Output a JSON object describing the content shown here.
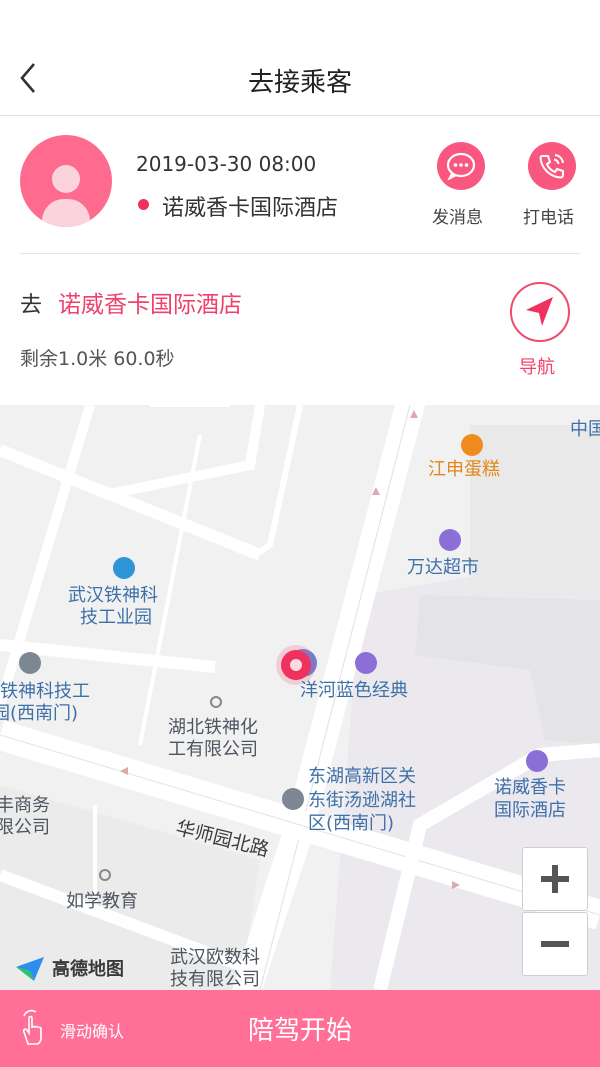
{
  "header": {
    "title": "去接乘客",
    "back_icon": "chevron-left-icon"
  },
  "passenger": {
    "time": "2019-03-30 08:00",
    "location": "诺威香卡国际酒店",
    "location_dot_color": "#f0315f",
    "actions": {
      "message_label": "发消息",
      "call_label": "打电话"
    }
  },
  "destination": {
    "prefix": "去",
    "name": "诺威香卡国际酒店",
    "remaining": "剩余1.0米   60.0秒",
    "nav_label": "导航"
  },
  "map": {
    "pois": [
      "中国",
      "江申蛋糕",
      "万达超市",
      "武汉铁神科",
      "技工业园",
      "铁神科技工",
      "园(西南门)",
      "洋河蓝色经典",
      "湖北铁神化",
      "工有限公司",
      "东湖高新区关",
      "东街汤逊湖社",
      "区(西南门)",
      "诺威香卡",
      "国际酒店",
      "丰商务",
      "限公司",
      "如学教育",
      "武汉欧数科",
      "技有限公司"
    ],
    "road": "华师园北路",
    "logo": "高德地图",
    "zoom_in": "+",
    "zoom_out": "−"
  },
  "bottom": {
    "swipe_label": "滑动确认",
    "start_label": "陪驾开始"
  },
  "colors": {
    "accent": "#f0416a",
    "button": "#f9577f",
    "bottom_bar": "#ff6f96"
  }
}
